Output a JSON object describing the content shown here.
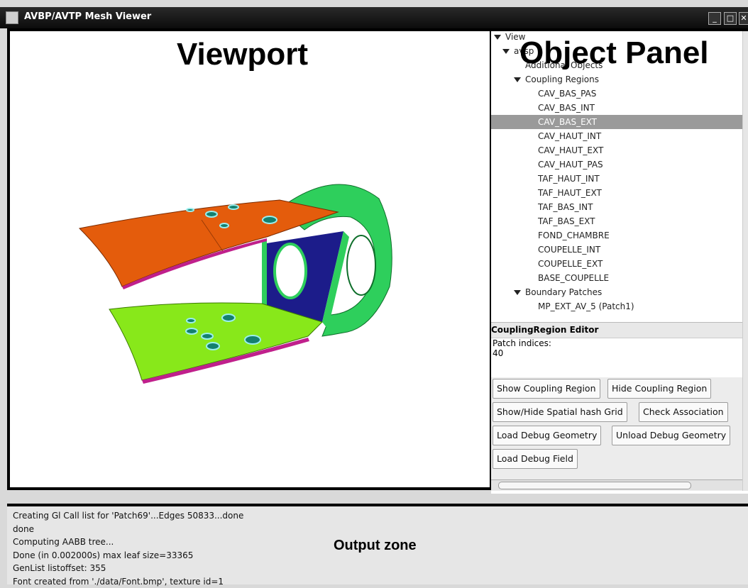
{
  "window": {
    "title": "AVBP/AVTP Mesh Viewer",
    "minimize": "_",
    "maximize": "□",
    "close": "✕"
  },
  "labels": {
    "viewport": "Viewport",
    "object_panel": "Object Panel",
    "output_zone": "Output zone"
  },
  "tree": {
    "root": "View",
    "avsp": "avsp",
    "additional": "Additional Objects",
    "coupling_regions": "Coupling Regions",
    "regions": [
      "CAV_BAS_PAS",
      "CAV_BAS_INT",
      "CAV_BAS_EXT",
      "CAV_HAUT_INT",
      "CAV_HAUT_EXT",
      "CAV_HAUT_PAS",
      "TAF_HAUT_INT",
      "TAF_HAUT_EXT",
      "TAF_BAS_INT",
      "TAF_BAS_EXT",
      "FOND_CHAMBRE",
      "COUPELLE_INT",
      "COUPELLE_EXT",
      "BASE_COUPELLE"
    ],
    "selected": "CAV_BAS_EXT",
    "boundary_patches": "Boundary Patches",
    "patch_item": "MP_EXT_AV_5 (Patch1)"
  },
  "editor": {
    "title": "CouplingRegion Editor",
    "patch_label": "Patch indices:",
    "patch_value": "40"
  },
  "buttons": {
    "show_coupling": "Show Coupling Region",
    "hide_coupling": "Hide Coupling Region",
    "toggle_hash": "Show/Hide Spatial hash Grid",
    "check_assoc": "Check Association",
    "load_debug_geom": "Load Debug Geometry",
    "unload_debug_geom": "Unload Debug Geometry",
    "load_debug_field": "Load Debug Field"
  },
  "log": [
    "Creating Gl Call list for 'Patch69'...Edges 50833...done",
    "done",
    "Computing AABB tree...",
    "Done (in 0.002000s) max leaf size=33365",
    "GenList listoffset: 355",
    "Font created from './data/Font.bmp', texture id=1"
  ],
  "colors": {
    "upper_panel": "#e45c0c",
    "lower_panel": "#88e81a",
    "frame": "#2ecf5c",
    "back_wall": "#1c1c8a"
  }
}
